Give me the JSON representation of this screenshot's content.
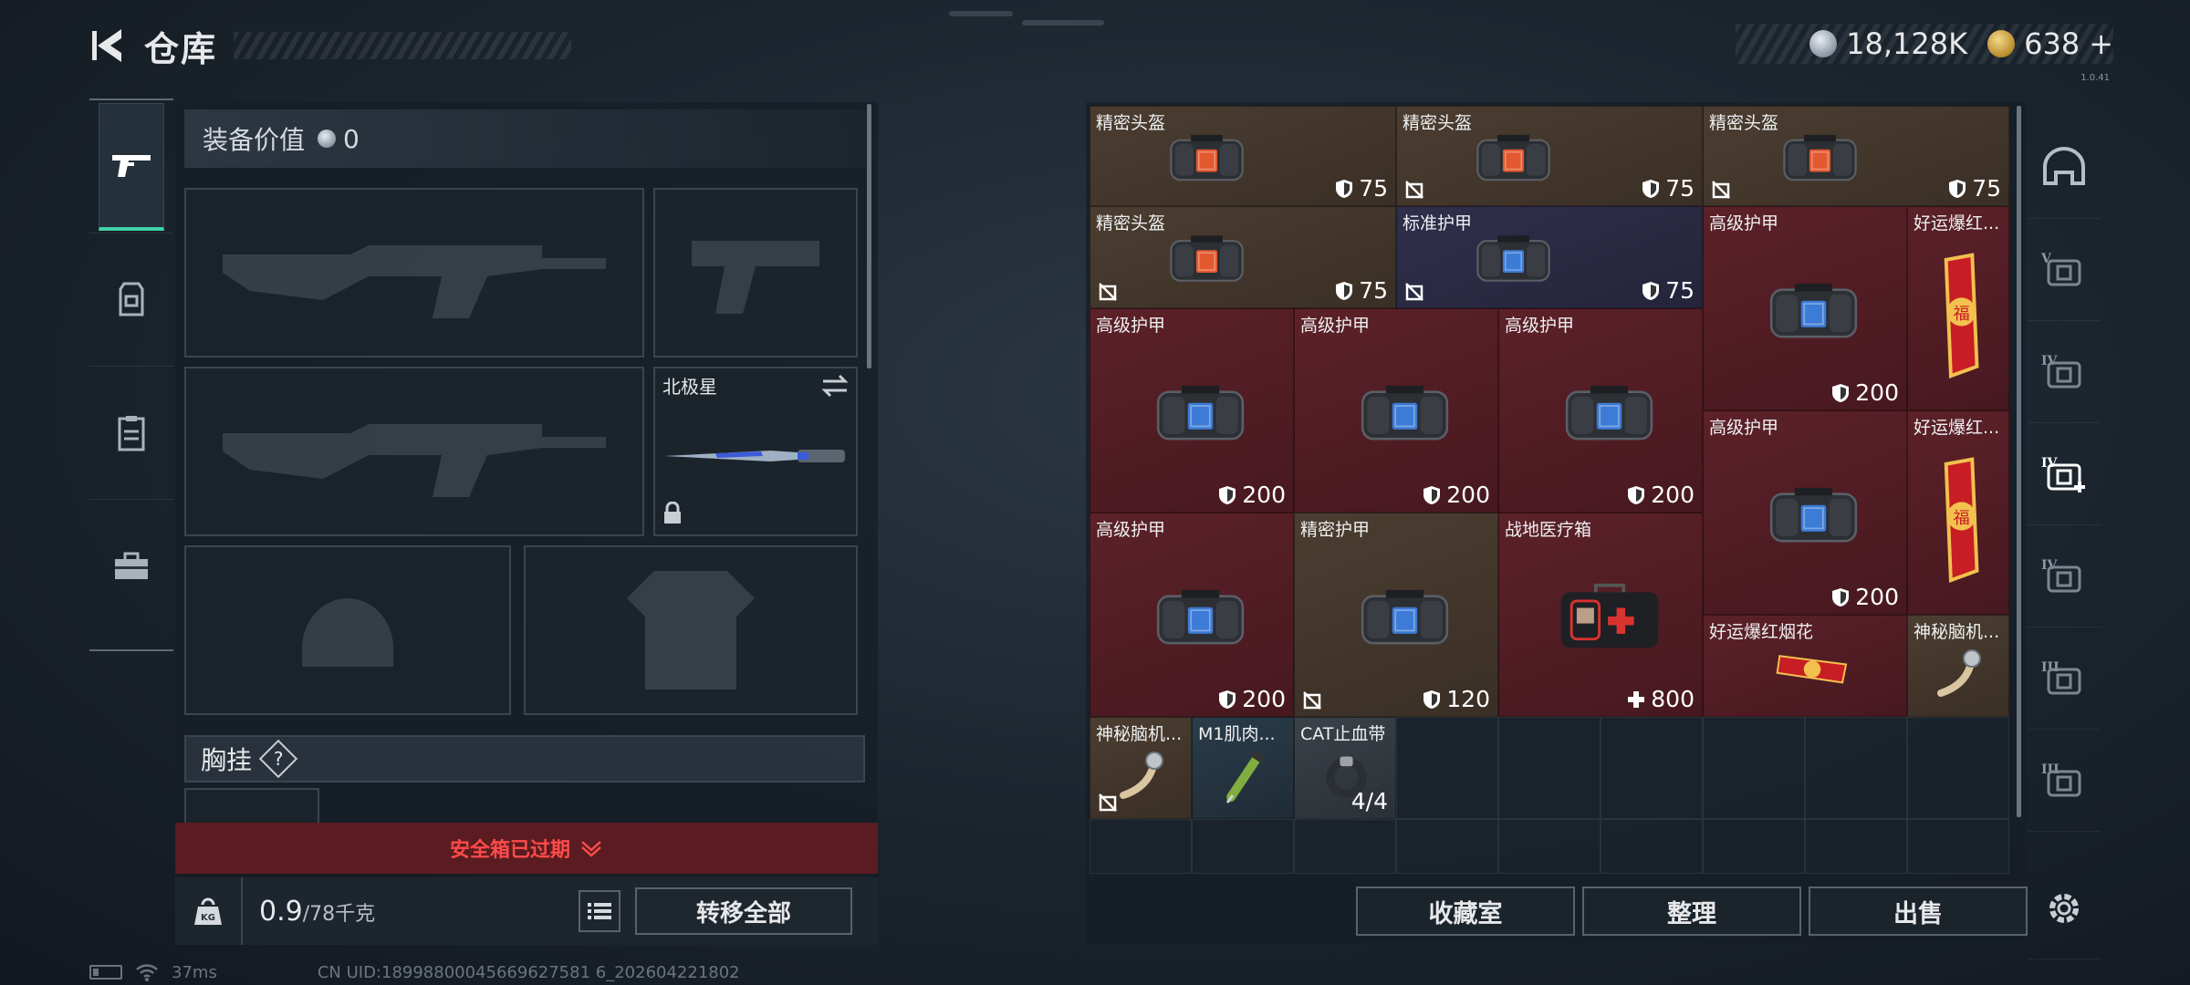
{
  "header": {
    "title": "仓库",
    "back_icon": "back-arrow-icon",
    "silver_amount": "18,128K",
    "gold_amount": "638",
    "gold_add": "+",
    "version_text": "1.0.41"
  },
  "colors": {
    "accent": "#3fd3a6",
    "rarity_gold": "#4a3a2c",
    "rarity_purple": "#2c2c48",
    "rarity_red": "#5a1f26",
    "expired": "#ff4b4b"
  },
  "left_rail": {
    "items": [
      {
        "name": "weapon-icon",
        "active": true
      },
      {
        "name": "armor-icon",
        "active": false
      },
      {
        "name": "chest-rig-icon",
        "active": false
      },
      {
        "name": "briefcase-icon",
        "active": false
      }
    ]
  },
  "loadout": {
    "value_label": "装备价值",
    "value": "0",
    "secondary_slot_label": "北极星",
    "chest_label": "胸挂",
    "chest_help": "?",
    "safebox_expired": "安全箱已过期",
    "weight_current": "0.9",
    "weight_max": "/78千克",
    "transfer_all": "转移全部"
  },
  "status": {
    "ping": "37ms",
    "uid": "CN UID:18998800045669627581 6_202604221802"
  },
  "stash": {
    "items": [
      {
        "name": "精密头盔",
        "value": "75",
        "kind": "helmet",
        "rarity": "gold",
        "nodrop": false
      },
      {
        "name": "精密头盔",
        "value": "75",
        "kind": "helmet",
        "rarity": "gold",
        "nodrop": true
      },
      {
        "name": "精密头盔",
        "value": "75",
        "kind": "helmet",
        "rarity": "gold",
        "nodrop": true
      },
      {
        "name": "精密头盔",
        "value": "75",
        "kind": "helmet",
        "rarity": "gold",
        "nodrop": true
      },
      {
        "name": "标准护甲",
        "value": "75",
        "kind": "armor",
        "rarity": "purple",
        "nodrop": true
      },
      {
        "name": "高级护甲",
        "value": "200",
        "kind": "armor",
        "rarity": "red",
        "nodrop": false
      },
      {
        "name": "好运爆红...",
        "value": "",
        "kind": "firework",
        "rarity": "red",
        "nodrop": false
      },
      {
        "name": "高级护甲",
        "value": "200",
        "kind": "armor",
        "rarity": "red",
        "nodrop": false
      },
      {
        "name": "高级护甲",
        "value": "200",
        "kind": "armor",
        "rarity": "red",
        "nodrop": false
      },
      {
        "name": "高级护甲",
        "value": "200",
        "kind": "armor",
        "rarity": "red",
        "nodrop": false
      },
      {
        "name": "高级护甲",
        "value": "200",
        "kind": "armor",
        "rarity": "red",
        "nodrop": false
      },
      {
        "name": "好运爆红...",
        "value": "",
        "kind": "firework",
        "rarity": "red",
        "nodrop": false
      },
      {
        "name": "高级护甲",
        "value": "200",
        "kind": "armor",
        "rarity": "red",
        "nodrop": false
      },
      {
        "name": "精密护甲",
        "value": "120",
        "kind": "armor",
        "rarity": "gold",
        "nodrop": true
      },
      {
        "name": "战地医疗箱",
        "value": "800",
        "kind": "medkit",
        "rarity": "red",
        "nodrop": false
      },
      {
        "name": "好运爆红烟花",
        "value": "",
        "kind": "firework-wide",
        "rarity": "red",
        "nodrop": false
      },
      {
        "name": "神秘脑机...",
        "value": "",
        "kind": "implant",
        "rarity": "gold",
        "nodrop": false
      },
      {
        "name": "神秘脑机...",
        "value": "",
        "kind": "implant",
        "rarity": "gold",
        "nodrop": true
      },
      {
        "name": "M1肌肉...",
        "value": "",
        "kind": "syringe",
        "rarity": "blue",
        "nodrop": false
      },
      {
        "name": "CAT止血带",
        "value": "4/4",
        "kind": "tourniquet",
        "rarity": "grey",
        "nodrop": false
      }
    ],
    "buttons": {
      "collection": "收藏室",
      "organize": "整理",
      "sell": "出售"
    }
  },
  "right_rail": {
    "items": [
      {
        "name": "helmet-slot-icon",
        "label": ""
      },
      {
        "name": "armor-v-icon",
        "label": "V"
      },
      {
        "name": "armor-iv-icon",
        "label": "IV"
      },
      {
        "name": "medkit-iv-icon",
        "label": "IV"
      },
      {
        "name": "armor-iv-b-icon",
        "label": "IV"
      },
      {
        "name": "armor-iii-icon",
        "label": "III"
      },
      {
        "name": "armor-iii-b-icon",
        "label": "III"
      },
      {
        "name": "settings-gear-icon",
        "label": ""
      }
    ]
  }
}
